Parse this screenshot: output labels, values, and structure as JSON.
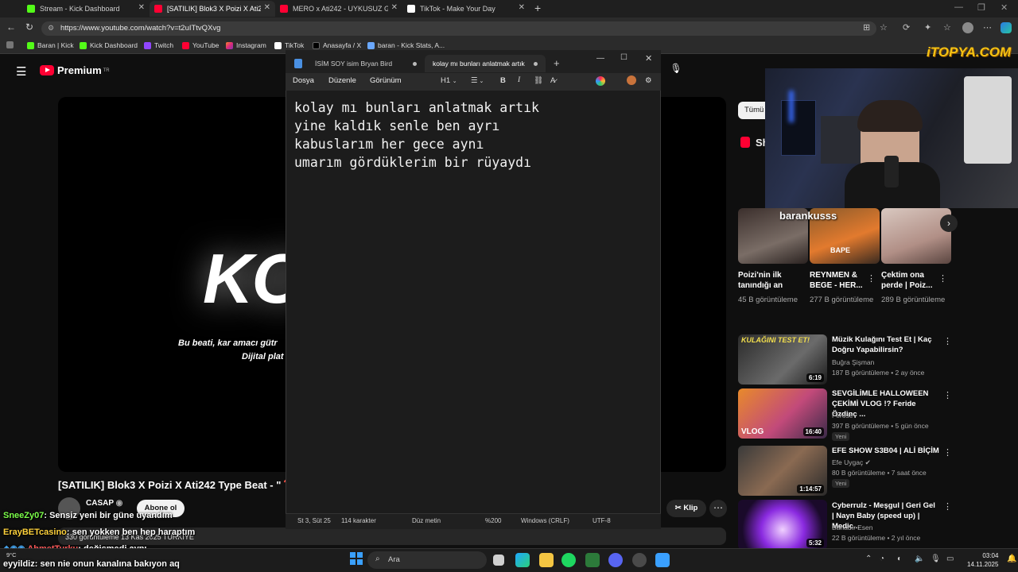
{
  "browser": {
    "tabs": [
      {
        "title": "Stream - Kick Dashboard",
        "color": "#53fc18"
      },
      {
        "title": "[SATILIK] Blok3 X Poizi X Ati242 T...",
        "color": "#ff0033"
      },
      {
        "title": "MERO x Ati242 - UYKUSUZ GECE...",
        "color": "#ff0033"
      },
      {
        "title": "TikTok - Make Your Day",
        "color": "#ffffff"
      }
    ],
    "url": "https://www.youtube.com/watch?v=t2uITtvQXvg",
    "bookmarks": [
      "Baran | Kick",
      "Kick Dashboard",
      "Twitch",
      "YouTube",
      "Instagram",
      "TikTok",
      "Anasayfa / X",
      "baran - Kick Stats, A..."
    ]
  },
  "youtube": {
    "logo": "Premium",
    "logo_region": "TR",
    "player_big_text": "KO",
    "player_sub1": "Bu beati, kar amacı gütr",
    "player_sub2": "Dijital plat",
    "video_title": "[SATILIK] Blok3 X Poizi X Ati242 Type Beat - \"",
    "channel_name": "CASAP",
    "subscribe_label": "Abone ol",
    "clip_label": "Klip",
    "desc_line": "330 görüntüleme  13 Kas 2025  TÜRKİYE",
    "filter_chip": "Tümü",
    "shorts_title": "Sh",
    "shorts": [
      {
        "title": "Poizi'nin ilk tanındığı an",
        "views": "45 B görüntüleme"
      },
      {
        "title": "REYNMEN & BEGE - HER...",
        "views": "277 B görüntüleme"
      },
      {
        "title": "Çektim ona perde | Poiz...",
        "views": "289 B görüntüleme"
      }
    ],
    "videos": [
      {
        "title": "Müzik Kulağını Test Et | Kaç Doğru Yapabilirsin?",
        "channel": "Buğra Şişman",
        "meta": "187 B görüntüleme • 2 ay önce",
        "duration": "6:19",
        "badge": ""
      },
      {
        "title": "SEVGİLİMLE HALLOWEEN ÇEKİMİ VLOG !? Feride Özdinç ...",
        "channel": "Ferose",
        "meta": "397 B görüntüleme • 5 gün önce",
        "duration": "16:40",
        "badge": "Yeni"
      },
      {
        "title": "EFE SHOW S3B04 | ALİ BİÇİM",
        "channel": "Efe Uygaç",
        "meta": "80 B görüntüleme • 7 saat önce",
        "duration": "1:14:57",
        "badge": "Yeni"
      },
      {
        "title": "Cyberrulz - Meşgul | Geri Gel | Nayn Baby (speed up) | Medic...",
        "channel": "Bahadır Esen",
        "meta": "22 B görüntüleme • 2 yıl önce",
        "duration": "5:32",
        "badge": ""
      }
    ]
  },
  "webcam": {
    "overlay_name": "barankusss",
    "brand": "iTOPYA.COM"
  },
  "notepad": {
    "tabs": [
      "İSİM  SOY isim  Bryan Bird",
      "kolay mı bunları anlatmak artık"
    ],
    "menu": [
      "Dosya",
      "Düzenle",
      "Görünüm"
    ],
    "heading": "H1",
    "text": "kolay mı bunları anlatmak artık\nyine kaldık senle ben ayrı\nkabuslarım her gece aynı\numarım gördüklerim bir rüyaydı",
    "status": [
      "St 3, Süt 25",
      "114 karakter",
      "Düz metin",
      "%200",
      "Windows (CRLF)",
      "UTF-8"
    ]
  },
  "chat": [
    {
      "user": "SneeZy07",
      "msg": ": Sensiz yeni bir güne uyandım",
      "color": "#7cff4a"
    },
    {
      "user": "ErayBETcasino",
      "msg": ": sen yokken ben hep haraptım",
      "color": "#ffd23c"
    },
    {
      "user": "AhmetTurku",
      "msg": ": değişmedi aynı",
      "color": "#ff5a5a"
    },
    {
      "user": "eyyildiz",
      "msg": ": sen nie onun kanalına bakıyon aq",
      "color": "#ffffff"
    }
  ],
  "taskbar": {
    "search": "Ara",
    "time": "03:04",
    "date": "14.11.2025",
    "weather": "9°C"
  }
}
